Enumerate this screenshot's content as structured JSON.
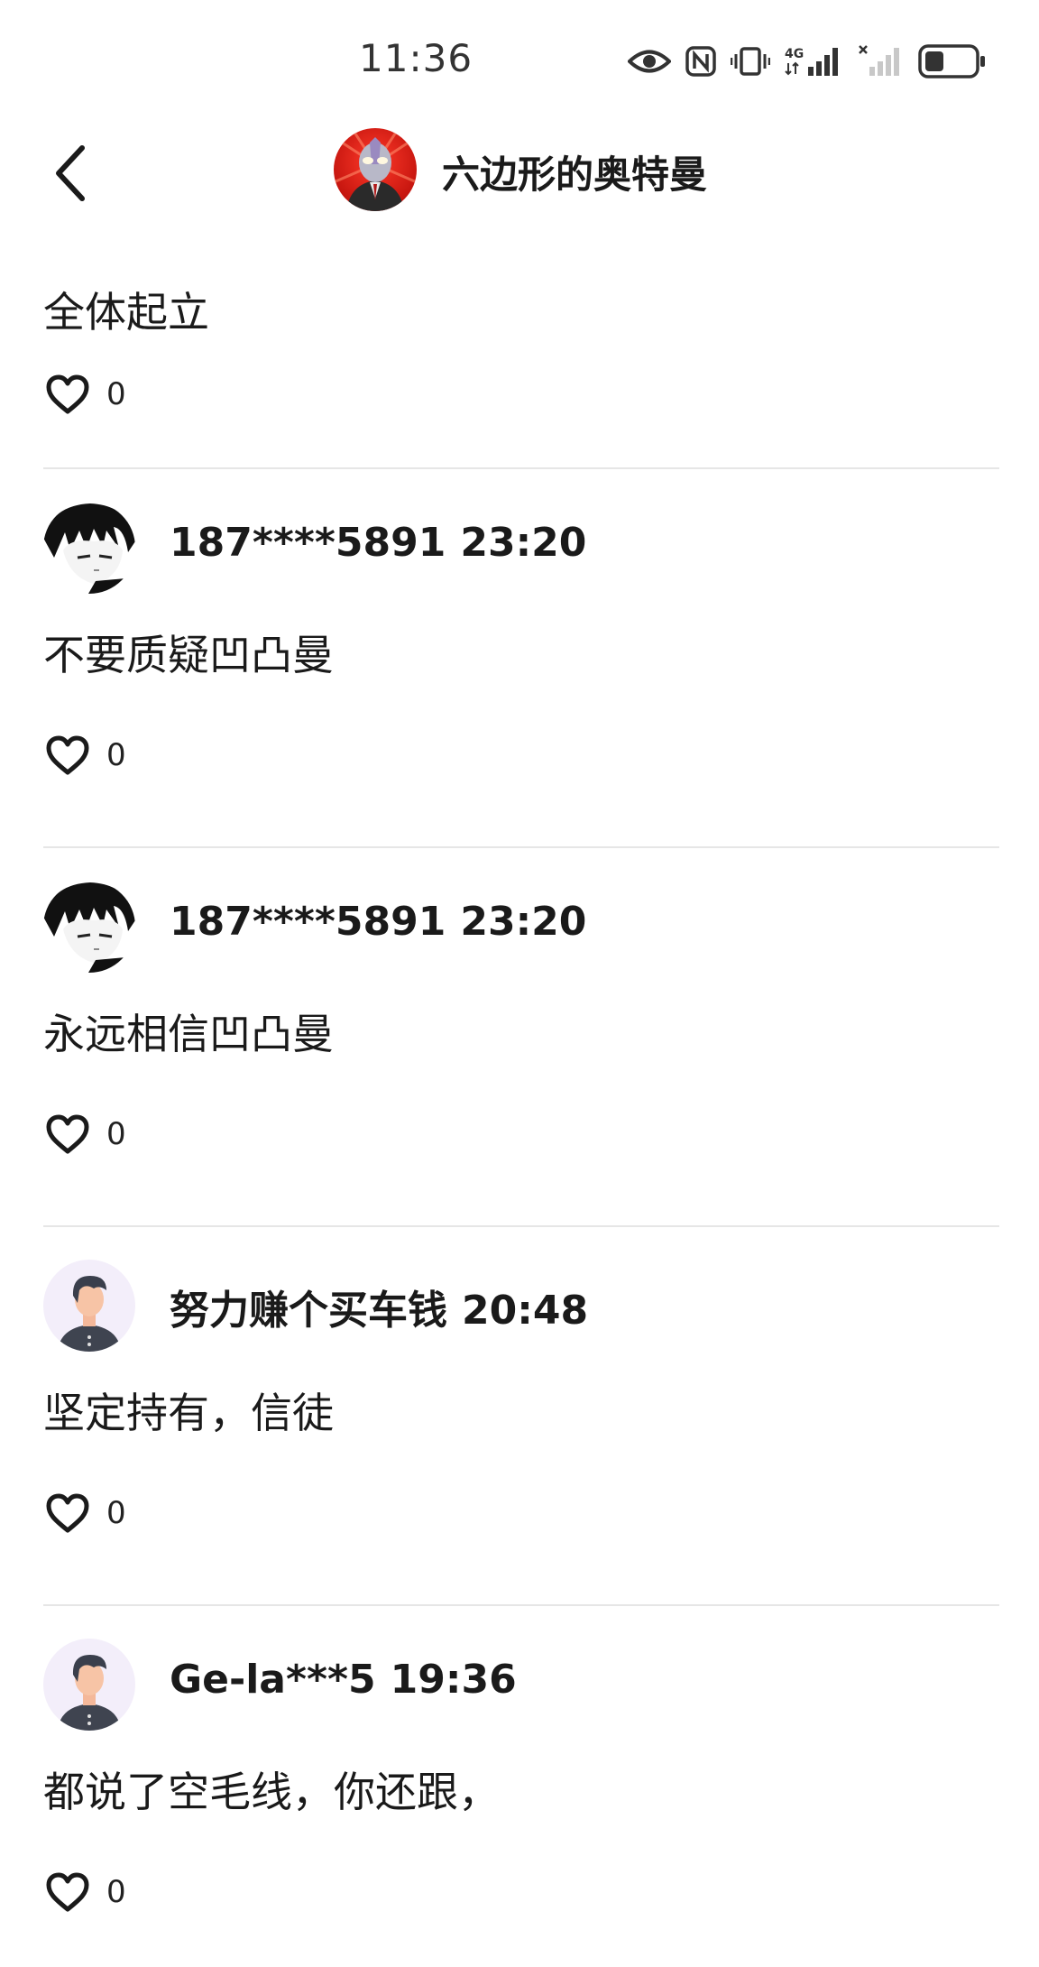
{
  "status_bar": {
    "time": "11:36",
    "network": "4G",
    "icons": [
      "eye-icon",
      "nfc-icon",
      "vibrate-icon",
      "signal-4g-icon",
      "signal-no-service-icon",
      "battery-icon"
    ]
  },
  "header": {
    "back_icon": "chevron-left-icon",
    "title": "六边形的奥特曼"
  },
  "comments": [
    {
      "user": "",
      "time": "",
      "text": "全体起立",
      "likes": "0"
    },
    {
      "user": "187****5891",
      "time": "23:20",
      "avatar": "anime-avatar",
      "text": "不要质疑凹凸曼",
      "likes": "0"
    },
    {
      "user": "187****5891",
      "time": "23:20",
      "avatar": "anime-avatar",
      "text": "永远相信凹凸曼",
      "likes": "0"
    },
    {
      "user": "努力赚个买车钱",
      "time": "20:48",
      "avatar": "default-avatar",
      "text": "坚定持有，信徒",
      "likes": "0"
    },
    {
      "user": "Ge-la***5",
      "time": "19:36",
      "avatar": "default-avatar",
      "text": "都说了空毛线，你还跟，",
      "likes": "0"
    }
  ],
  "colors": {
    "divider": "#e6e6e6",
    "text": "#1a1a1a",
    "avatar_bg": "#f3eefa"
  }
}
